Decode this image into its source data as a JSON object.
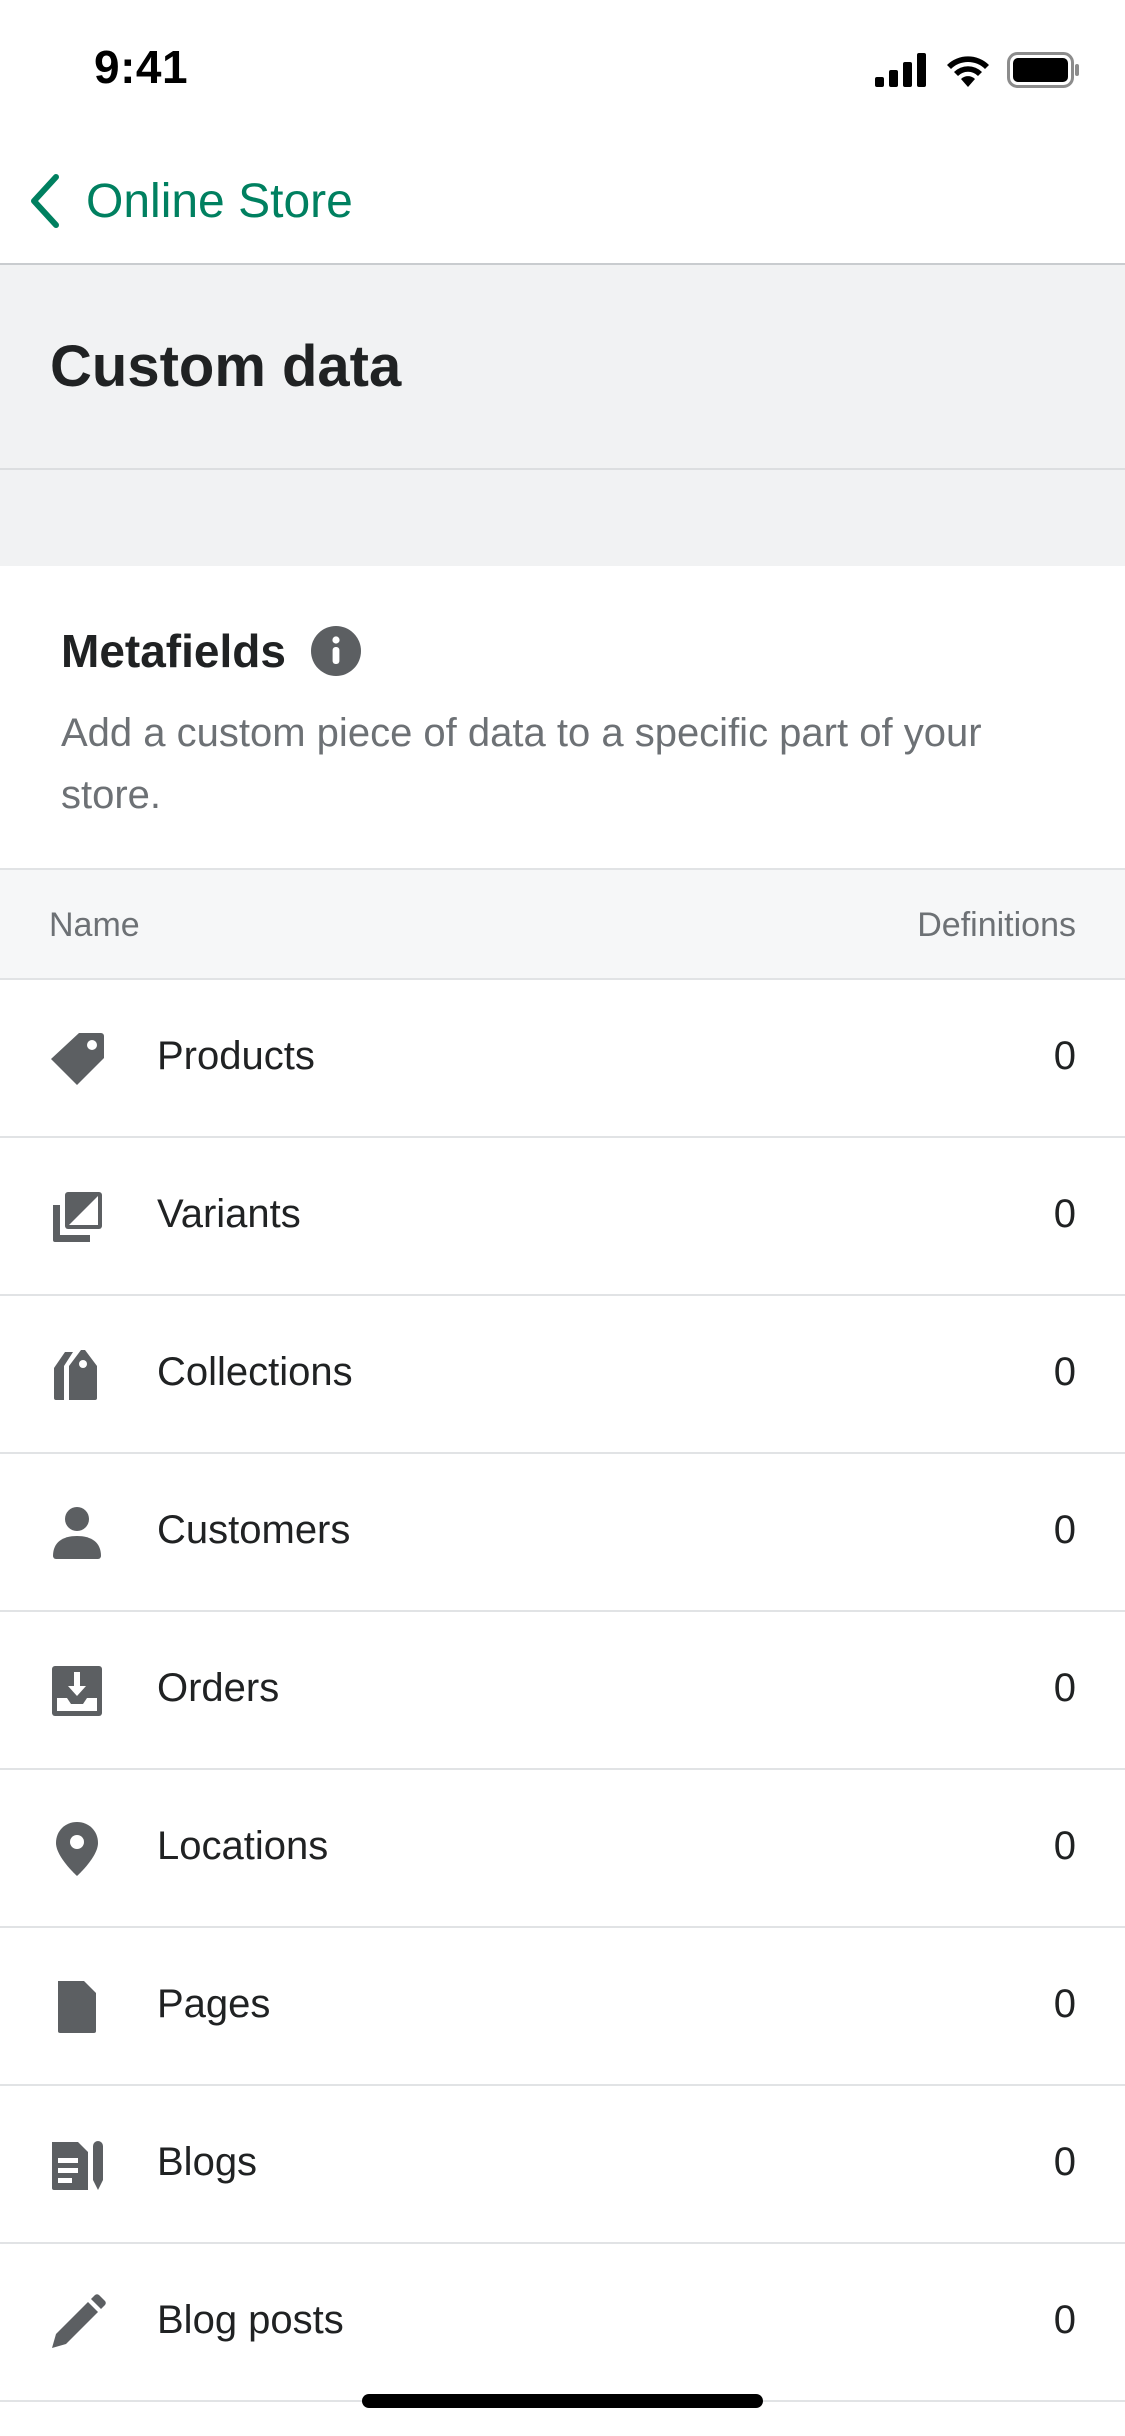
{
  "status_bar": {
    "time": "9:41"
  },
  "nav": {
    "back_label": "Online Store"
  },
  "page": {
    "title": "Custom data"
  },
  "metafields": {
    "title": "Metafields",
    "description": "Add a custom piece of data to a specific part of your store.",
    "columns": {
      "name": "Name",
      "definitions": "Definitions"
    },
    "rows": [
      {
        "label": "Products",
        "count": "0",
        "icon": "tag-icon"
      },
      {
        "label": "Variants",
        "count": "0",
        "icon": "variants-icon"
      },
      {
        "label": "Collections",
        "count": "0",
        "icon": "collections-icon"
      },
      {
        "label": "Customers",
        "count": "0",
        "icon": "customer-icon"
      },
      {
        "label": "Orders",
        "count": "0",
        "icon": "orders-inbox-icon"
      },
      {
        "label": "Locations",
        "count": "0",
        "icon": "location-pin-icon"
      },
      {
        "label": "Pages",
        "count": "0",
        "icon": "page-icon"
      },
      {
        "label": "Blogs",
        "count": "0",
        "icon": "blog-icon"
      },
      {
        "label": "Blog posts",
        "count": "0",
        "icon": "pencil-icon"
      }
    ]
  },
  "colors": {
    "accent": "#008060",
    "icon": "#5c5f62",
    "background_band": "#f1f2f3",
    "text_primary": "#202223",
    "text_secondary": "#6d7175"
  }
}
